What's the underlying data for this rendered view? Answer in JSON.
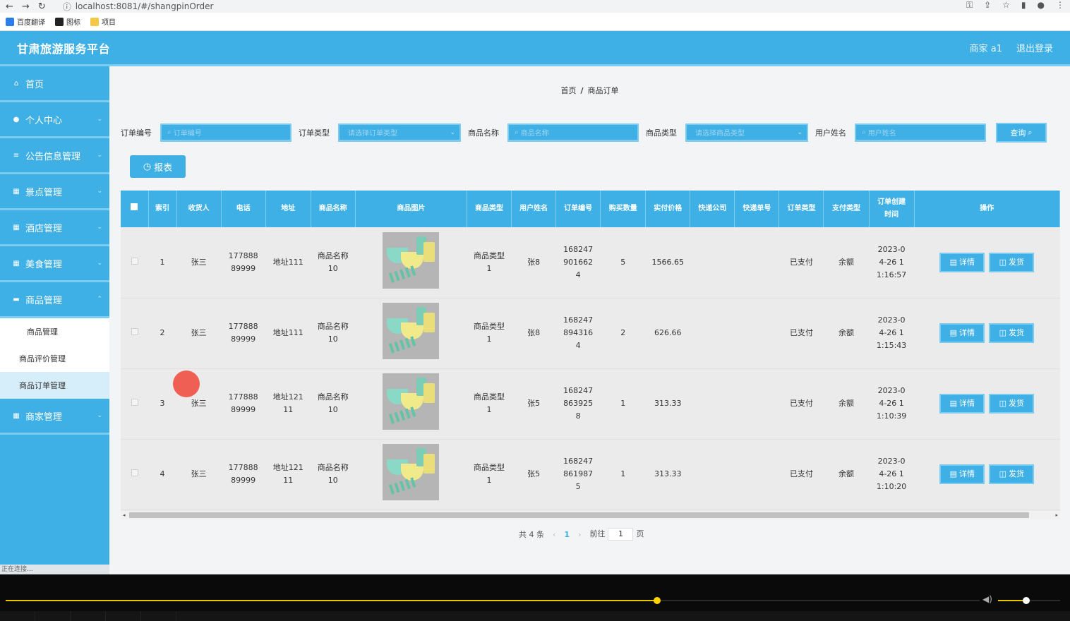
{
  "browser": {
    "url": "localhost:8081/#/shangpinOrder",
    "bookmarks": [
      "百度翻译",
      "图标",
      "项目"
    ]
  },
  "header": {
    "title": "甘肃旅游服务平台",
    "user": "商家 a1",
    "logout": "退出登录"
  },
  "sidebar": {
    "items": [
      {
        "label": "首页",
        "icon": "home-icon"
      },
      {
        "label": "个人中心",
        "icon": "user-icon"
      },
      {
        "label": "公告信息管理",
        "icon": "list-icon"
      },
      {
        "label": "景点管理",
        "icon": "grid-icon"
      },
      {
        "label": "酒店管理",
        "icon": "grid-icon"
      },
      {
        "label": "美食管理",
        "icon": "grid-icon"
      },
      {
        "label": "商品管理",
        "icon": "chat-icon"
      }
    ],
    "sub_items": [
      "商品管理",
      "商品评价管理",
      "商品订单管理"
    ],
    "last_item": {
      "label": "商家管理",
      "icon": "grid-icon"
    },
    "status": "正在连接..."
  },
  "breadcrumb": {
    "home": "首页",
    "current": "商品订单"
  },
  "filters": {
    "order_no_label": "订单编号",
    "order_no_placeholder": "订单编号",
    "order_type_label": "订单类型",
    "order_type_placeholder": "请选择订单类型",
    "product_name_label": "商品名称",
    "product_name_placeholder": "商品名称",
    "product_type_label": "商品类型",
    "product_type_placeholder": "请选择商品类型",
    "username_label": "用户姓名",
    "username_placeholder": "用户姓名",
    "query": "查询"
  },
  "report_button": "报表",
  "table": {
    "headers": [
      "索引",
      "收货人",
      "电话",
      "地址",
      "商品名称",
      "商品图片",
      "商品类型",
      "用户姓名",
      "订单编号",
      "购买数量",
      "实付价格",
      "快递公司",
      "快递单号",
      "订单类型",
      "支付类型",
      "订单创建时间",
      "操作"
    ],
    "rows": [
      {
        "index": "1",
        "receiver": "张三",
        "phone": "17788889999",
        "address": "地址111",
        "product_name": "商品名称10",
        "product_type": "商品类型1",
        "username": "张8",
        "order_no": "1682479016624",
        "qty": "5",
        "price": "1566.65",
        "courier": "",
        "tracking": "",
        "order_type": "已支付",
        "pay_type": "余额",
        "created": "2023-04-26 11:16:57"
      },
      {
        "index": "2",
        "receiver": "张三",
        "phone": "17788889999",
        "address": "地址111",
        "product_name": "商品名称10",
        "product_type": "商品类型1",
        "username": "张8",
        "order_no": "1682478943164",
        "qty": "2",
        "price": "626.66",
        "courier": "",
        "tracking": "",
        "order_type": "已支付",
        "pay_type": "余额",
        "created": "2023-04-26 11:15:43"
      },
      {
        "index": "3",
        "receiver": "张三",
        "phone": "17788889999",
        "address": "地址12111",
        "product_name": "商品名称10",
        "product_type": "商品类型1",
        "username": "张5",
        "order_no": "1682478639258",
        "qty": "1",
        "price": "313.33",
        "courier": "",
        "tracking": "",
        "order_type": "已支付",
        "pay_type": "余额",
        "created": "2023-04-26 11:10:39"
      },
      {
        "index": "4",
        "receiver": "张三",
        "phone": "17788889999",
        "address": "地址12111",
        "product_name": "商品名称10",
        "product_type": "商品类型1",
        "username": "张5",
        "order_no": "1682478619875",
        "qty": "1",
        "price": "313.33",
        "courier": "",
        "tracking": "",
        "order_type": "已支付",
        "pay_type": "余额",
        "created": "2023-04-26 11:10:20"
      }
    ],
    "detail_label": "详情",
    "ship_label": "发货"
  },
  "pagination": {
    "total": "共 4 条",
    "current_page": "1",
    "goto_prefix": "前往",
    "goto_value": "1",
    "goto_suffix": "页"
  },
  "colors": {
    "primary": "#3fb0e6",
    "primary_light": "#7dcbef",
    "content_bg": "#f3f4f6"
  }
}
